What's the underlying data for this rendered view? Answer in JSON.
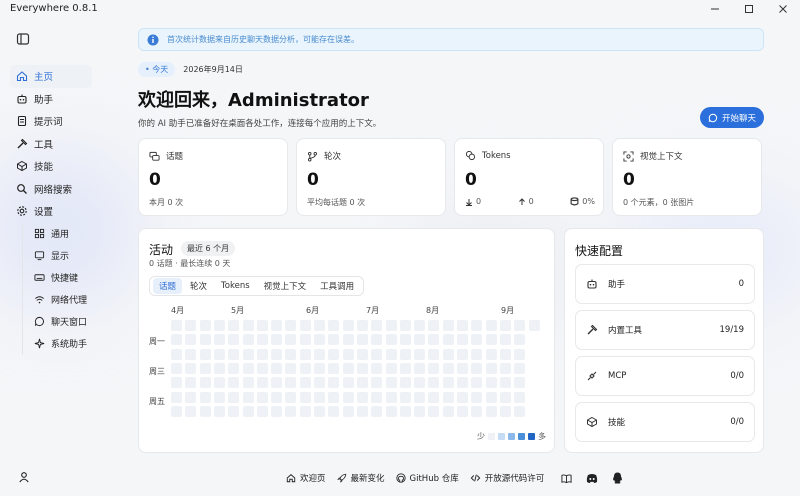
{
  "window": {
    "title": "Everywhere 0.8.1"
  },
  "notice": "首次统计数据来自历史聊天数据分析，可能存在误差。",
  "header": {
    "today_label": "今天",
    "date": "2026年9月14日",
    "welcome": "欢迎回来，Administrator",
    "subtitle": "你的 AI 助手已准备好在桌面各处工作，连接每个应用的上下文。",
    "start_chat": "开始聊天"
  },
  "sidebar": {
    "items": [
      {
        "label": "主页",
        "icon": "home-icon"
      },
      {
        "label": "助手",
        "icon": "robot-icon"
      },
      {
        "label": "提示词",
        "icon": "document-icon"
      },
      {
        "label": "工具",
        "icon": "hammer-icon"
      },
      {
        "label": "技能",
        "icon": "cube-icon"
      },
      {
        "label": "网络搜索",
        "icon": "search-icon"
      },
      {
        "label": "设置",
        "icon": "gear-icon"
      }
    ],
    "settings_items": [
      {
        "label": "通用",
        "icon": "grid-icon"
      },
      {
        "label": "显示",
        "icon": "display-icon"
      },
      {
        "label": "快捷键",
        "icon": "keyboard-icon"
      },
      {
        "label": "网络代理",
        "icon": "wifi-icon"
      },
      {
        "label": "聊天窗口",
        "icon": "chat-icon"
      },
      {
        "label": "系统助手",
        "icon": "sparkle-icon"
      }
    ]
  },
  "stats": [
    {
      "title": "话题",
      "value": "0",
      "footer": [
        "本月 0 次"
      ]
    },
    {
      "title": "轮次",
      "value": "0",
      "footer": [
        "平均每话题 0 次"
      ]
    },
    {
      "title": "Tokens",
      "value": "0",
      "footer": [
        "0",
        "0",
        "0%"
      ]
    },
    {
      "title": "视觉上下文",
      "value": "0",
      "footer": [
        "0 个元素，0 张图片"
      ]
    }
  ],
  "activity": {
    "title": "活动",
    "range": "最近 6 个月",
    "subtitle": "0 话题 · 最长连续 0 天",
    "tabs": [
      "话题",
      "轮次",
      "Tokens",
      "视觉上下文",
      "工具调用"
    ],
    "months": [
      "4月",
      "5月",
      "6月",
      "7月",
      "8月",
      "9月"
    ],
    "days": [
      "周一",
      "周三",
      "周五"
    ],
    "legend_less": "少",
    "legend_more": "多",
    "legend_colors": [
      "#eef1f5",
      "#c6dcf5",
      "#8db9ea",
      "#4a8fd9",
      "#2166c4"
    ]
  },
  "quick_config": {
    "title": "快速配置",
    "items": [
      {
        "label": "助手",
        "value": "0",
        "icon": "robot-icon"
      },
      {
        "label": "内置工具",
        "value": "19/19",
        "icon": "hammer-icon"
      },
      {
        "label": "MCP",
        "value": "0/0",
        "icon": "plug-icon"
      },
      {
        "label": "技能",
        "value": "0/0",
        "icon": "cube-icon"
      }
    ]
  },
  "footer": {
    "links": [
      {
        "label": "欢迎页",
        "icon": "home-icon"
      },
      {
        "label": "最新变化",
        "icon": "rocket-icon"
      },
      {
        "label": "GitHub 仓库",
        "icon": "github-icon"
      },
      {
        "label": "开放源代码许可",
        "icon": "code-icon"
      }
    ]
  }
}
